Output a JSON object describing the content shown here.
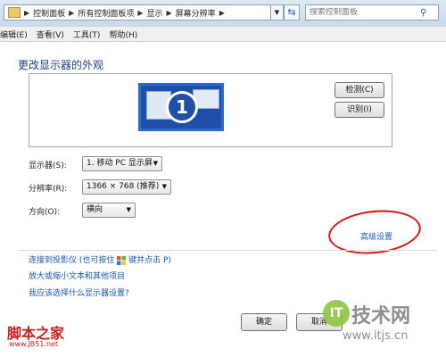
{
  "address_bar": {
    "crumbs": [
      "控制面板",
      "所有控制面板项",
      "显示",
      "屏幕分辨率"
    ],
    "search_placeholder": "搜索控制面板"
  },
  "menu": [
    "编辑(E)",
    "查看(V)",
    "工具(T)",
    "帮助(H)"
  ],
  "page": {
    "title": "更改显示器的外观",
    "monitor_number": "1",
    "detect_label": "检测(C)",
    "identify_label": "识别(I)"
  },
  "settings": {
    "display_label": "显示器(S):",
    "display_value": "1. 移动 PC 显示屏",
    "resolution_label": "分辨率(R):",
    "resolution_value": "1366 × 768 (推荐)",
    "orientation_label": "方向(O):",
    "orientation_value": "横向"
  },
  "advanced_link": "高级设置",
  "links": {
    "projector": "连接到投影仪 (也可按住",
    "projector_suffix": "键并点击 P)",
    "text_size": "放大或缩小文本和其他项目",
    "which_settings": "我应该选择什么显示器设置?"
  },
  "buttons": {
    "ok": "确定",
    "cancel": "取消"
  },
  "watermarks": {
    "left_big": "脚本之家",
    "left_small": "www.JB51.net",
    "right_badge": "IT",
    "right_big": "技术网",
    "right_small": "www.itjs.cn"
  },
  "colors": {
    "link": "#1a55b8",
    "annotation": "#d71616"
  }
}
